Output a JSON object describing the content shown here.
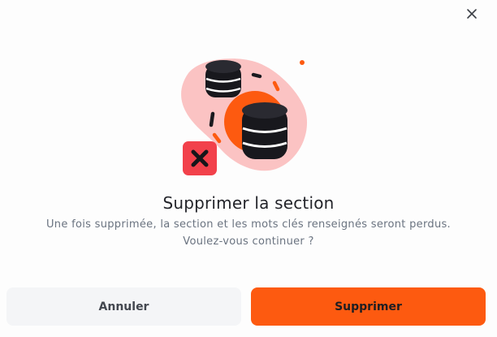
{
  "dialog": {
    "title": "Supprimer la section",
    "message_line1": "Une fois supprimée, la section et les mots clés renseignés seront perdus.",
    "message_line2": "Voulez-vous continuer ?",
    "close_icon": "close-icon",
    "illustration_icons": [
      "database-icon",
      "database-icon",
      "delete-x-icon"
    ]
  },
  "buttons": {
    "cancel_label": "Annuler",
    "confirm_label": "Supprimer"
  },
  "colors": {
    "accent": "#fd5a10",
    "danger": "#f2414b",
    "blob": "#fbc3c3",
    "cancel_bg": "#f4f5f7"
  }
}
